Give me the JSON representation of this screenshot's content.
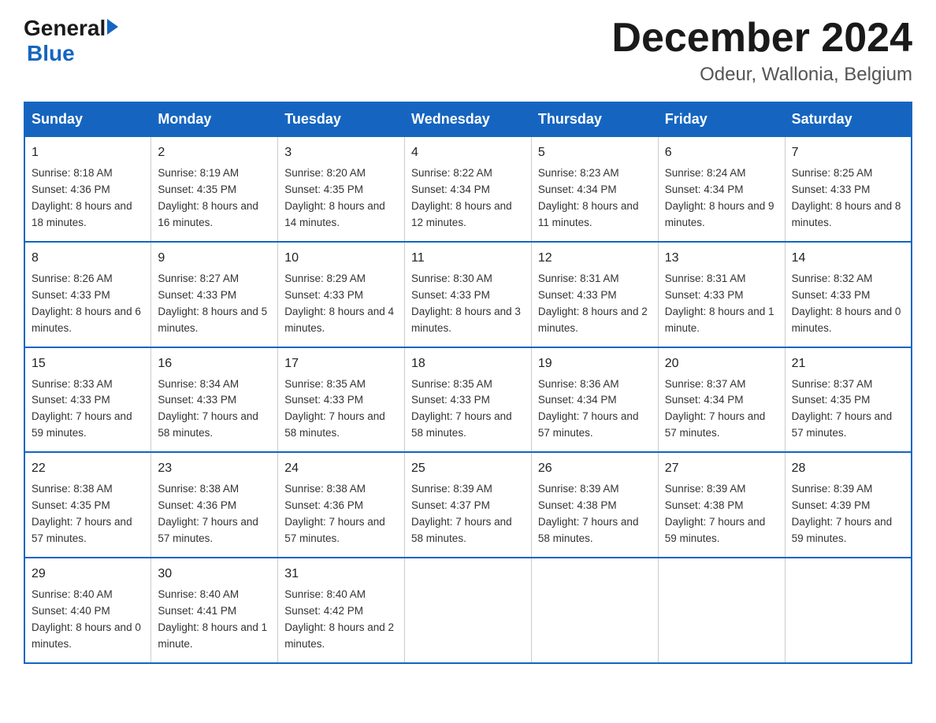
{
  "logo": {
    "line1": "General",
    "arrow": "▶",
    "line2": "Blue"
  },
  "header": {
    "month_title": "December 2024",
    "subtitle": "Odeur, Wallonia, Belgium"
  },
  "weekdays": [
    "Sunday",
    "Monday",
    "Tuesday",
    "Wednesday",
    "Thursday",
    "Friday",
    "Saturday"
  ],
  "weeks": [
    [
      {
        "day": "1",
        "sunrise": "8:18 AM",
        "sunset": "4:36 PM",
        "daylight": "8 hours and 18 minutes."
      },
      {
        "day": "2",
        "sunrise": "8:19 AM",
        "sunset": "4:35 PM",
        "daylight": "8 hours and 16 minutes."
      },
      {
        "day": "3",
        "sunrise": "8:20 AM",
        "sunset": "4:35 PM",
        "daylight": "8 hours and 14 minutes."
      },
      {
        "day": "4",
        "sunrise": "8:22 AM",
        "sunset": "4:34 PM",
        "daylight": "8 hours and 12 minutes."
      },
      {
        "day": "5",
        "sunrise": "8:23 AM",
        "sunset": "4:34 PM",
        "daylight": "8 hours and 11 minutes."
      },
      {
        "day": "6",
        "sunrise": "8:24 AM",
        "sunset": "4:34 PM",
        "daylight": "8 hours and 9 minutes."
      },
      {
        "day": "7",
        "sunrise": "8:25 AM",
        "sunset": "4:33 PM",
        "daylight": "8 hours and 8 minutes."
      }
    ],
    [
      {
        "day": "8",
        "sunrise": "8:26 AM",
        "sunset": "4:33 PM",
        "daylight": "8 hours and 6 minutes."
      },
      {
        "day": "9",
        "sunrise": "8:27 AM",
        "sunset": "4:33 PM",
        "daylight": "8 hours and 5 minutes."
      },
      {
        "day": "10",
        "sunrise": "8:29 AM",
        "sunset": "4:33 PM",
        "daylight": "8 hours and 4 minutes."
      },
      {
        "day": "11",
        "sunrise": "8:30 AM",
        "sunset": "4:33 PM",
        "daylight": "8 hours and 3 minutes."
      },
      {
        "day": "12",
        "sunrise": "8:31 AM",
        "sunset": "4:33 PM",
        "daylight": "8 hours and 2 minutes."
      },
      {
        "day": "13",
        "sunrise": "8:31 AM",
        "sunset": "4:33 PM",
        "daylight": "8 hours and 1 minute."
      },
      {
        "day": "14",
        "sunrise": "8:32 AM",
        "sunset": "4:33 PM",
        "daylight": "8 hours and 0 minutes."
      }
    ],
    [
      {
        "day": "15",
        "sunrise": "8:33 AM",
        "sunset": "4:33 PM",
        "daylight": "7 hours and 59 minutes."
      },
      {
        "day": "16",
        "sunrise": "8:34 AM",
        "sunset": "4:33 PM",
        "daylight": "7 hours and 58 minutes."
      },
      {
        "day": "17",
        "sunrise": "8:35 AM",
        "sunset": "4:33 PM",
        "daylight": "7 hours and 58 minutes."
      },
      {
        "day": "18",
        "sunrise": "8:35 AM",
        "sunset": "4:33 PM",
        "daylight": "7 hours and 58 minutes."
      },
      {
        "day": "19",
        "sunrise": "8:36 AM",
        "sunset": "4:34 PM",
        "daylight": "7 hours and 57 minutes."
      },
      {
        "day": "20",
        "sunrise": "8:37 AM",
        "sunset": "4:34 PM",
        "daylight": "7 hours and 57 minutes."
      },
      {
        "day": "21",
        "sunrise": "8:37 AM",
        "sunset": "4:35 PM",
        "daylight": "7 hours and 57 minutes."
      }
    ],
    [
      {
        "day": "22",
        "sunrise": "8:38 AM",
        "sunset": "4:35 PM",
        "daylight": "7 hours and 57 minutes."
      },
      {
        "day": "23",
        "sunrise": "8:38 AM",
        "sunset": "4:36 PM",
        "daylight": "7 hours and 57 minutes."
      },
      {
        "day": "24",
        "sunrise": "8:38 AM",
        "sunset": "4:36 PM",
        "daylight": "7 hours and 57 minutes."
      },
      {
        "day": "25",
        "sunrise": "8:39 AM",
        "sunset": "4:37 PM",
        "daylight": "7 hours and 58 minutes."
      },
      {
        "day": "26",
        "sunrise": "8:39 AM",
        "sunset": "4:38 PM",
        "daylight": "7 hours and 58 minutes."
      },
      {
        "day": "27",
        "sunrise": "8:39 AM",
        "sunset": "4:38 PM",
        "daylight": "7 hours and 59 minutes."
      },
      {
        "day": "28",
        "sunrise": "8:39 AM",
        "sunset": "4:39 PM",
        "daylight": "7 hours and 59 minutes."
      }
    ],
    [
      {
        "day": "29",
        "sunrise": "8:40 AM",
        "sunset": "4:40 PM",
        "daylight": "8 hours and 0 minutes."
      },
      {
        "day": "30",
        "sunrise": "8:40 AM",
        "sunset": "4:41 PM",
        "daylight": "8 hours and 1 minute."
      },
      {
        "day": "31",
        "sunrise": "8:40 AM",
        "sunset": "4:42 PM",
        "daylight": "8 hours and 2 minutes."
      },
      null,
      null,
      null,
      null
    ]
  ]
}
